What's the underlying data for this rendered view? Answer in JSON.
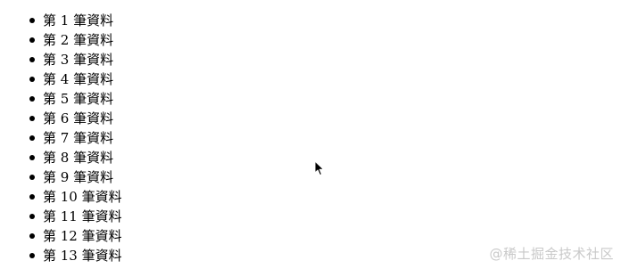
{
  "list": {
    "items": [
      "第 1 筆資料",
      "第 2 筆資料",
      "第 3 筆資料",
      "第 4 筆資料",
      "第 5 筆資料",
      "第 6 筆資料",
      "第 7 筆資料",
      "第 8 筆資料",
      "第 9 筆資料",
      "第 10 筆資料",
      "第 11 筆資料",
      "第 12 筆資料",
      "第 13 筆資料"
    ]
  },
  "cursor": {
    "icon": "mouse-pointer-icon"
  },
  "watermark": {
    "text": "@稀土掘金技术社区"
  }
}
